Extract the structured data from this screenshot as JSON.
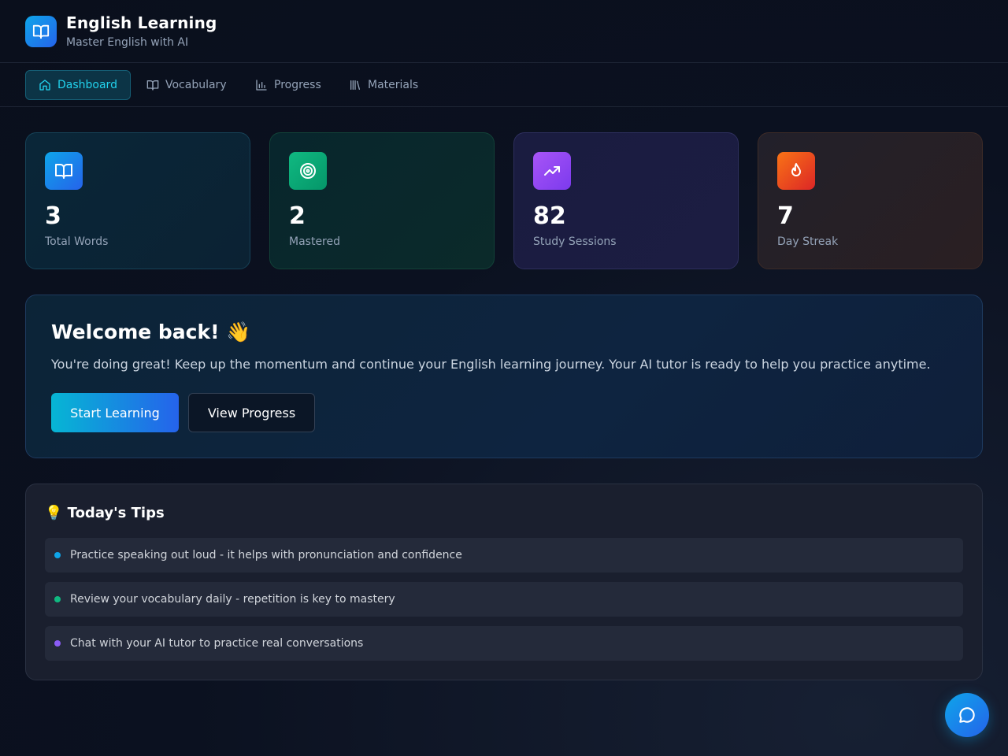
{
  "header": {
    "title": "English Learning",
    "subtitle": "Master English with AI",
    "logo_icon": "open-book-icon"
  },
  "nav": {
    "items": [
      {
        "label": "Dashboard",
        "icon": "home-icon",
        "active": true
      },
      {
        "label": "Vocabulary",
        "icon": "book-icon",
        "active": false
      },
      {
        "label": "Progress",
        "icon": "bar-chart-icon",
        "active": false
      },
      {
        "label": "Materials",
        "icon": "library-icon",
        "active": false
      }
    ]
  },
  "stats": [
    {
      "value": "3",
      "label": "Total Words",
      "icon": "book-open-icon",
      "color": "#0ea5e9"
    },
    {
      "value": "2",
      "label": "Mastered",
      "icon": "target-icon",
      "color": "#10b981"
    },
    {
      "value": "82",
      "label": "Study Sessions",
      "icon": "trending-up-icon",
      "color": "#8b5cf6"
    },
    {
      "value": "7",
      "label": "Day Streak",
      "icon": "flame-icon",
      "color": "#f97316"
    }
  ],
  "welcome": {
    "title": "Welcome back! 👋",
    "message": "You're doing great! Keep up the momentum and continue your English learning journey. Your AI tutor is ready to help you practice anytime.",
    "primary_button": "Start Learning",
    "secondary_button": "View Progress"
  },
  "tips": {
    "title": "💡 Today's Tips",
    "items": [
      {
        "text": "Practice speaking out loud - it helps with pronunciation and confidence",
        "color": "#0ea5e9"
      },
      {
        "text": "Review your vocabulary daily - repetition is key to mastery",
        "color": "#10b981"
      },
      {
        "text": "Chat with your AI tutor to practice real conversations",
        "color": "#8b5cf6"
      }
    ]
  },
  "chat": {
    "icon": "chat-bubble-icon"
  }
}
